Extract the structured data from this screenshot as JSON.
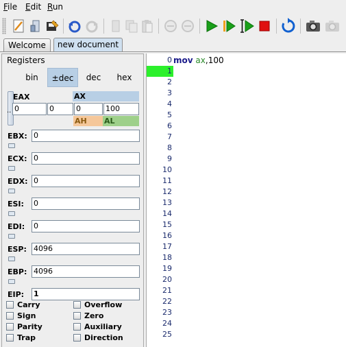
{
  "menu": [
    {
      "label": "File",
      "mnemonic": "F",
      "rest": "ile"
    },
    {
      "label": "Edit",
      "mnemonic": "E",
      "rest": "dit"
    },
    {
      "label": "Run",
      "mnemonic": "R",
      "rest": "un"
    }
  ],
  "toolbar": {
    "icons": [
      "new-file-icon",
      "open-file-icon",
      "save-file-icon",
      "undo-icon",
      "redo-icon",
      "cut-icon",
      "copy-icon",
      "paste-icon",
      "step-back-icon",
      "step-forward-icon",
      "run-icon",
      "step-icon",
      "run-to-cursor-icon",
      "stop-icon",
      "reset-icon",
      "camera-icon",
      "camera-disabled-icon"
    ],
    "colors": {
      "run": "#1aa01a",
      "stop": "#e01010",
      "reset": "#1060d0"
    }
  },
  "tabs": [
    {
      "label": "Welcome",
      "active": false
    },
    {
      "label": "new document",
      "active": true
    }
  ],
  "registers": {
    "title": "Registers",
    "formats": [
      "bin",
      "±dec",
      "dec",
      "hex"
    ],
    "selected_format": "±dec",
    "eax": {
      "label": "EAX",
      "ax_label": "AX",
      "ah_label": "AH",
      "al_label": "AL",
      "cells": [
        "0",
        "0",
        "0",
        "100"
      ]
    },
    "dots": "..",
    "list": [
      {
        "name": "EBX:",
        "value": "0"
      },
      {
        "name": "ECX:",
        "value": "0"
      },
      {
        "name": "EDX:",
        "value": "0"
      },
      {
        "name": "ESI:",
        "value": "0"
      },
      {
        "name": "EDI:",
        "value": "0"
      },
      {
        "name": "ESP:",
        "value": "4096"
      },
      {
        "name": "EBP:",
        "value": "4096"
      },
      {
        "name": "EIP:",
        "value": "1"
      }
    ],
    "flags": [
      {
        "label": "Carry",
        "checked": false
      },
      {
        "label": "Overflow",
        "checked": false
      },
      {
        "label": "Sign",
        "checked": false
      },
      {
        "label": "Zero",
        "checked": false
      },
      {
        "label": "Parity",
        "checked": false
      },
      {
        "label": "Auxiliary",
        "checked": false
      },
      {
        "label": "Trap",
        "checked": false
      },
      {
        "label": "Direction",
        "checked": false
      }
    ]
  },
  "editor": {
    "line_numbers": [
      "0",
      "1",
      "2",
      "3",
      "4",
      "5",
      "6",
      "7",
      "8",
      "9",
      "10",
      "11",
      "12",
      "13",
      "14",
      "15",
      "16",
      "17",
      "18",
      "19",
      "20",
      "21",
      "22",
      "23",
      "24",
      "25"
    ],
    "highlighted_line": "1",
    "highlight_color": "#2cf02c",
    "code": {
      "mnemonic": "mov",
      "operand1": "ax",
      "sep": ",",
      "operand2": "100"
    }
  }
}
